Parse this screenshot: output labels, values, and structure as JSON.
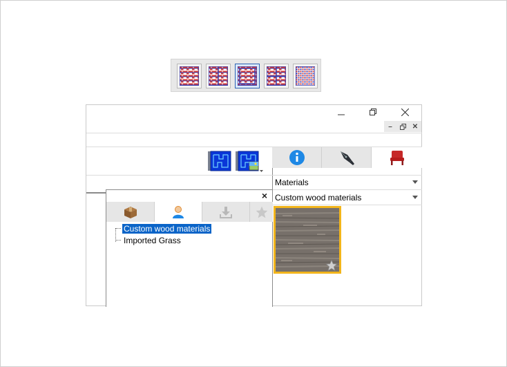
{
  "pattern_toolbar": {
    "buttons": [
      {
        "icon": "brick-pattern-icon",
        "selected": false
      },
      {
        "icon": "brick-pattern-icon",
        "selected": false
      },
      {
        "icon": "brick-pattern-icon",
        "selected": true
      },
      {
        "icon": "brick-pattern-icon",
        "selected": false
      },
      {
        "icon": "brick-pattern-icon",
        "selected": false
      }
    ]
  },
  "window": {
    "title_controls": {
      "minimize": "minimize-icon",
      "restore": "restore-icon",
      "close": "close-icon"
    },
    "mdi_controls": {
      "minimize": "–",
      "restore": "restore-icon",
      "close": "✕"
    },
    "toolbar": {
      "plan_buttons": [
        "floor-plan-icon",
        "floor-plan-image-icon"
      ],
      "tabs": [
        {
          "icon": "info-icon",
          "active": false
        },
        {
          "icon": "pen-nib-icon",
          "active": false
        },
        {
          "icon": "chair-icon",
          "active": true
        }
      ]
    },
    "category_dropdown": {
      "value": "Materials"
    },
    "collection_dropdown": {
      "value": "Custom wood materials"
    },
    "material_thumbnail": {
      "name": "wood-texture",
      "favorite_icon": "star-icon",
      "selected": true
    }
  },
  "panel": {
    "close_label": "×",
    "tabs": [
      {
        "icon": "box-icon",
        "active": false
      },
      {
        "icon": "user-icon",
        "active": true
      },
      {
        "icon": "download-icon",
        "active": false
      },
      {
        "icon": "star-icon",
        "active": false
      }
    ],
    "tree": [
      {
        "label": "Custom wood materials",
        "selected": true
      },
      {
        "label": "Imported Grass",
        "selected": false
      }
    ]
  },
  "colors": {
    "accent": "#0a64c8",
    "brick": "#c9302c",
    "mortar": "#3a3fb0",
    "selection": "#f2b51b",
    "chair": "#c62828"
  }
}
